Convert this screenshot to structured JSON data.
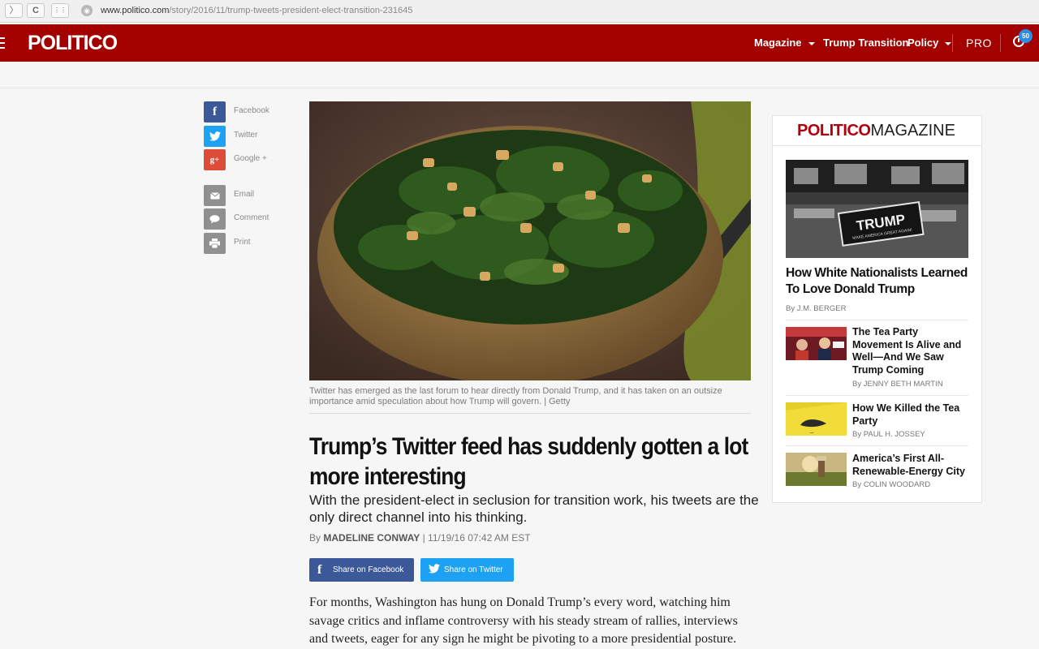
{
  "browser": {
    "back": "〉",
    "reload": "C",
    "apps": "⋮⋮",
    "url_domain": "www.politico.com",
    "url_path": "/story/2016/11/trump-tweets-president-elect-transition-231645"
  },
  "header": {
    "logo": "POLITICO",
    "nav": {
      "magazine": "Magazine",
      "trump_transition": "Trump Transition",
      "policy": "Policy",
      "pro": "PRO"
    },
    "notif_count": "50",
    "colors": {
      "bar": "#a30000",
      "badge": "#2a8de6"
    }
  },
  "share_sidebar": {
    "facebook": {
      "icon": "f",
      "label": "Facebook"
    },
    "twitter": {
      "icon": "twitter-bird",
      "label": "Twitter"
    },
    "google": {
      "icon": "g+",
      "label": "Google +"
    },
    "email": {
      "icon": "envelope",
      "label": "Email"
    },
    "comment": {
      "icon": "speech-bubble",
      "label": "Comment"
    },
    "print": {
      "icon": "printer",
      "label": "Print"
    }
  },
  "article": {
    "caption": "Twitter has emerged as the last forum to hear directly from Donald Trump, and it has taken on an outsize importance amid speculation about how Trump will govern. | Getty",
    "headline_1": "Trump’s Twitter feed has suddenly gotten a lot",
    "headline_2": "more interesting",
    "dek": "With the president-elect in seclusion for transition work, his tweets are the only direct channel into his thinking.",
    "by": "By",
    "author": "MADELINE CONWAY",
    "timestamp": "| 11/19/16 07:42 AM EST",
    "share_fb": "Share on Facebook",
    "share_tw": "Share on Twitter",
    "body": "For months, Washington has hung on Donald Trump’s every word, watching him savage critics and inflame controversy with his steady stream of rallies, interviews and tweets, eager for any sign he might be pivoting to a more presidential posture."
  },
  "magazine": {
    "brand_1": "POLITICO",
    "brand_2": "MAGAZINE",
    "featured": {
      "title": "How White Nationalists Learned To Love Donald Trump",
      "byline": "By J.M. BERGER",
      "sign_text": "TRUMP",
      "sign_sub": "MAKE AMERICA GREAT AGAIN!"
    },
    "stories": [
      {
        "title": "The Tea Party Movement Is Alive and Well—And We Saw Trump Coming",
        "byline": "By JENNY BETH MARTIN"
      },
      {
        "title": "How We Killed the Tea Party",
        "byline": "By PAUL H. JOSSEY"
      },
      {
        "title": "America’s First All-Renewable-Energy City",
        "byline": "By COLIN WOODARD"
      }
    ]
  }
}
